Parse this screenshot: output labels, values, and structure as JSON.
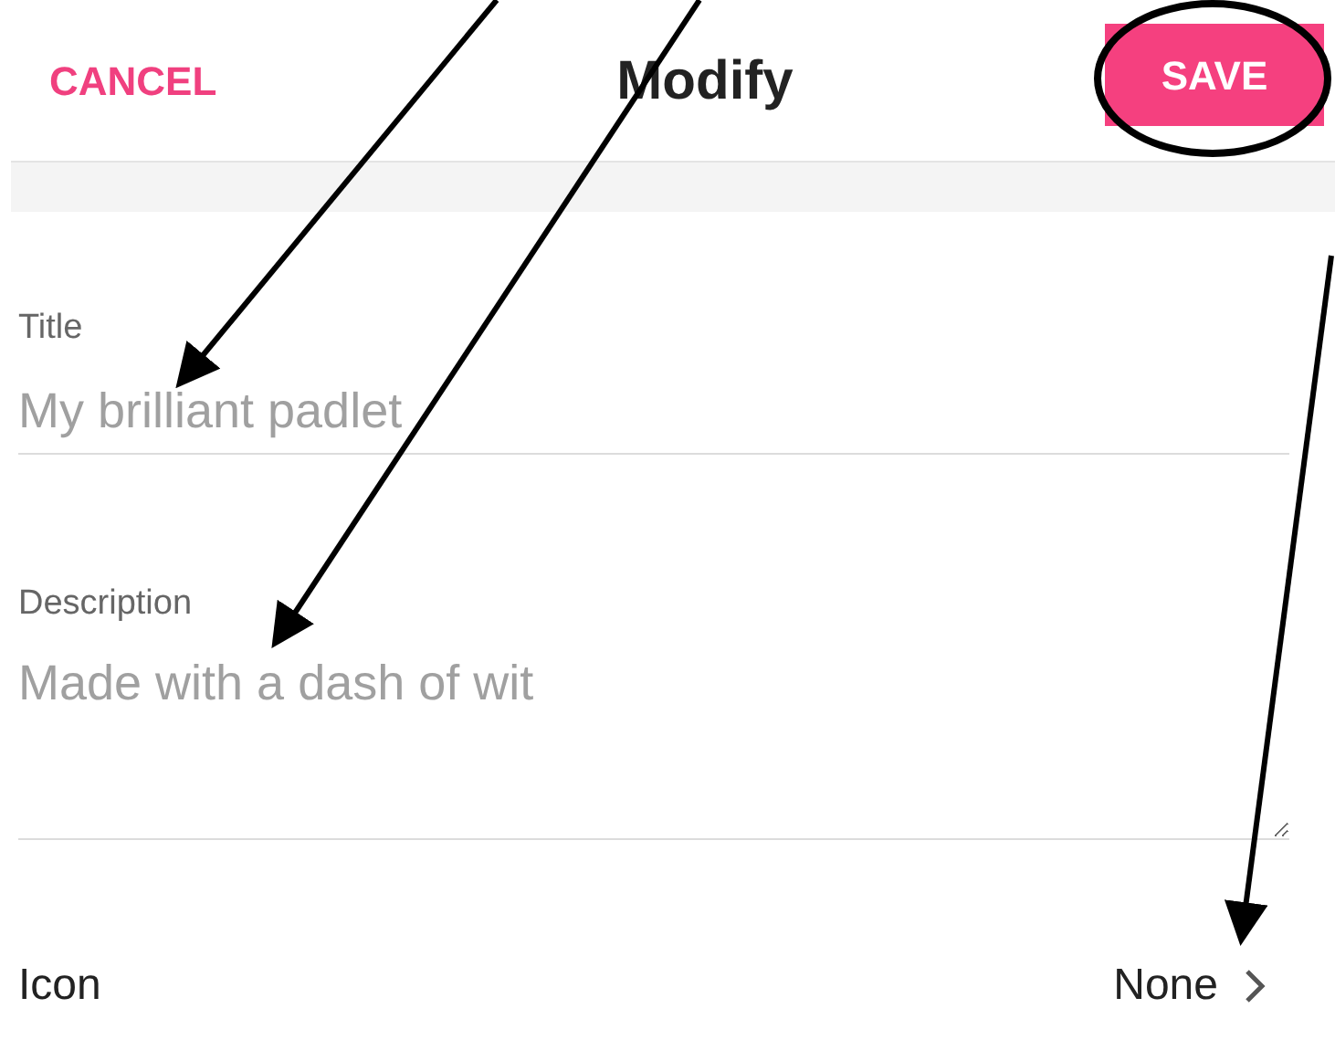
{
  "header": {
    "cancel": "CANCEL",
    "title": "Modify",
    "save": "SAVE"
  },
  "title_field": {
    "label": "Title",
    "placeholder": "My brilliant padlet"
  },
  "description_field": {
    "label": "Description",
    "placeholder": "Made with a dash of wit"
  },
  "icon_row": {
    "label": "Icon",
    "value": "None"
  }
}
